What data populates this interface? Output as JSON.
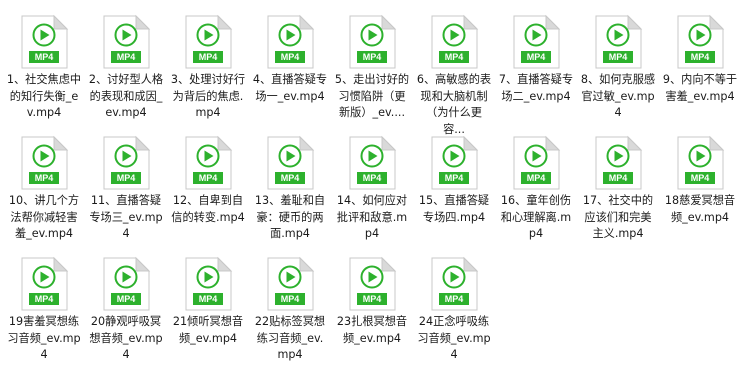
{
  "explorer": {
    "files": [
      {
        "name": "1、社交焦虑中的知行失衡_ev.mp4",
        "type": "MP4"
      },
      {
        "name": "2、讨好型人格的表现和成因_ev.mp4",
        "type": "MP4"
      },
      {
        "name": "3、处理讨好行为背后的焦虑.mp4",
        "type": "MP4"
      },
      {
        "name": "4、直播答疑专场一_ev.mp4",
        "type": "MP4"
      },
      {
        "name": "5、走出讨好的习惯陷阱（更新版）_ev....",
        "type": "MP4"
      },
      {
        "name": "6、高敏感的表现和大脑机制（为什么更容...",
        "type": "MP4"
      },
      {
        "name": "7、直播答疑专场二_ev.mp4",
        "type": "MP4"
      },
      {
        "name": "8、如何克服感官过敏_ev.mp4",
        "type": "MP4"
      },
      {
        "name": "9、内向不等于害羞_ev.mp4",
        "type": "MP4"
      },
      {
        "name": "10、讲几个方法帮你减轻害羞_ev.mp4",
        "type": "MP4"
      },
      {
        "name": "11、直播答疑专场三_ev.mp4",
        "type": "MP4"
      },
      {
        "name": "12、自卑到自信的转变.mp4",
        "type": "MP4"
      },
      {
        "name": "13、羞耻和自豪：硬币的两面.mp4",
        "type": "MP4"
      },
      {
        "name": "14、如何应对批评和敌意.mp4",
        "type": "MP4"
      },
      {
        "name": "15、直播答疑专场四.mp4",
        "type": "MP4"
      },
      {
        "name": "16、童年创伤和心理解离.mp4",
        "type": "MP4"
      },
      {
        "name": "17、社交中的应该们和完美主义.mp4",
        "type": "MP4"
      },
      {
        "name": "18慈爱冥想音频_ev.mp4",
        "type": "MP4"
      },
      {
        "name": "19害羞冥想练习音频_ev.mp4",
        "type": "MP4"
      },
      {
        "name": "20静观呼吸冥想音频_ev.mp4",
        "type": "MP4"
      },
      {
        "name": "21倾听冥想音频_ev.mp4",
        "type": "MP4"
      },
      {
        "name": "22贴标签冥想练习音频_ev.mp4",
        "type": "MP4"
      },
      {
        "name": "23扎根冥想音频_ev.mp4",
        "type": "MP4"
      },
      {
        "name": "24正念呼吸练习音频_ev.mp4",
        "type": "MP4"
      }
    ]
  },
  "colors": {
    "accent": "#2db12d",
    "page_fold": "#d7d7d7",
    "text": "#1a1a1a"
  },
  "icon": "mp4-video-file-icon"
}
